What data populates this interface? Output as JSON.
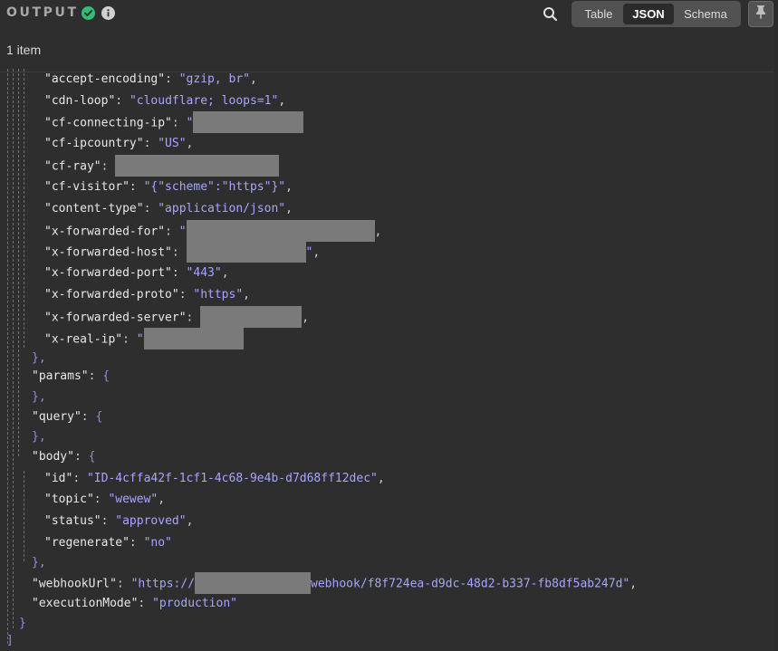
{
  "header": {
    "title": "OUTPUT",
    "status_icon": "check-circle-icon",
    "info_icon": "info-icon",
    "search_icon": "search-icon",
    "view_tabs": [
      "Table",
      "JSON",
      "Schema"
    ],
    "active_tab": "JSON",
    "pin_icon": "pin-icon"
  },
  "summary": {
    "item_count": "1 item"
  },
  "json": {
    "headers": {
      "accept_encoding": {
        "key": "\"accept-encoding\"",
        "value": "\"gzip, br\""
      },
      "cdn_loop": {
        "key": "\"cdn-loop\"",
        "value": "\"cloudflare; loops=1\""
      },
      "cf_connecting_ip": {
        "key": "\"cf-connecting-ip\"",
        "value": "\""
      },
      "cf_ipcountry": {
        "key": "\"cf-ipcountry\"",
        "value": "\"US\""
      },
      "cf_ray": {
        "key": "\"cf-ray\""
      },
      "cf_visitor": {
        "key": "\"cf-visitor\"",
        "value": "\"{\"scheme\":\"https\"}\""
      },
      "content_type": {
        "key": "\"content-type\"",
        "value": "\"application/json\""
      },
      "x_forwarded_for": {
        "key": "\"x-forwarded-for\"",
        "value": "\""
      },
      "x_forwarded_host": {
        "key": "\"x-forwarded-host\"",
        "value": "\""
      },
      "x_forwarded_port": {
        "key": "\"x-forwarded-port\"",
        "value": "\"443\""
      },
      "x_forwarded_proto": {
        "key": "\"x-forwarded-proto\"",
        "value": "\"https\""
      },
      "x_forwarded_server": {
        "key": "\"x-forwarded-server\""
      },
      "x_real_ip": {
        "key": "\"x-real-ip\"",
        "value": "\""
      }
    },
    "params_key": "\"params\"",
    "query_key": "\"query\"",
    "body_key": "\"body\"",
    "body": {
      "id": {
        "key": "\"id\"",
        "value": "\"ID-4cffa42f-1cf1-4c68-9e4b-d7d68ff12dec\""
      },
      "topic": {
        "key": "\"topic\"",
        "value": "\"wewew\""
      },
      "status": {
        "key": "\"status\"",
        "value": "\"approved\""
      },
      "regenerate": {
        "key": "\"regenerate\"",
        "value": "\"no\""
      }
    },
    "webhook_url": {
      "key": "\"webhookUrl\"",
      "value_start": "\"https://",
      "value_end": "webhook/f8f724ea-d9dc-48d2-b337-fb8df5ab247d\""
    },
    "execution_mode": {
      "key": "\"executionMode\"",
      "value": "\"production\""
    },
    "punct": {
      "colon": ": ",
      "comma": ",",
      "open": "{",
      "close": "}",
      "close_comma": "},",
      "array_close": "]"
    }
  },
  "colors": {
    "background": "#2e2e2e",
    "string": "#a9a4ff",
    "success": "#2fbe74",
    "redaction": "#7a7a7a"
  }
}
